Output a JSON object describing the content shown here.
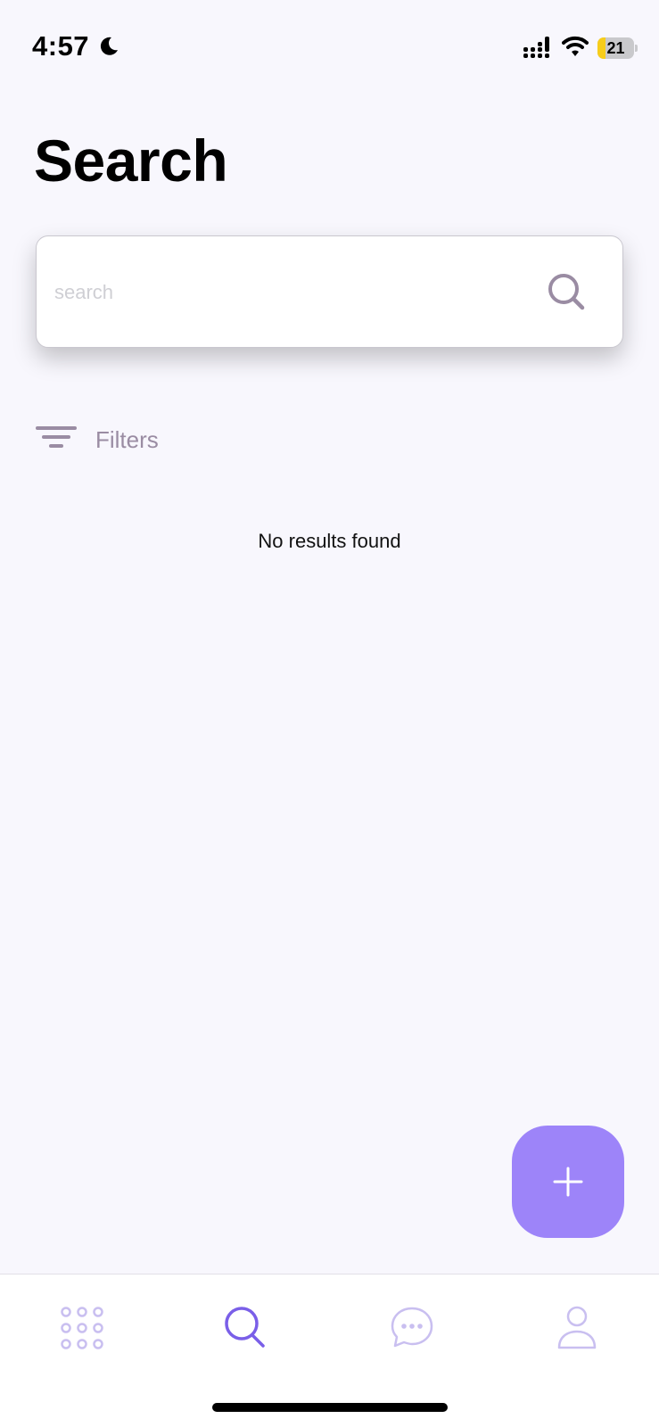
{
  "status_bar": {
    "time": "4:57",
    "battery_level": "21",
    "battery_fraction": 0.21,
    "moon_icon": "moon-icon",
    "signal_icon": "cellular-signal-icon",
    "wifi_icon": "wifi-icon"
  },
  "page": {
    "title": "Search"
  },
  "search": {
    "placeholder": "search",
    "value": "",
    "icon": "search-icon"
  },
  "filters": {
    "label": "Filters",
    "icon": "filter-icon"
  },
  "results": {
    "empty_message": "No results found"
  },
  "fab": {
    "icon": "plus-icon"
  },
  "tab_bar": {
    "tabs": [
      {
        "icon": "grid-icon",
        "active": false
      },
      {
        "icon": "search-icon",
        "active": true
      },
      {
        "icon": "chat-bubble-icon",
        "active": false
      },
      {
        "icon": "profile-icon",
        "active": false
      }
    ]
  },
  "colors": {
    "background": "#f8f7fd",
    "accent": "#9d84f9",
    "active_tab": "#7a5fe8",
    "inactive_tab": "#c9bff0",
    "muted_text": "#9a8ca3"
  }
}
